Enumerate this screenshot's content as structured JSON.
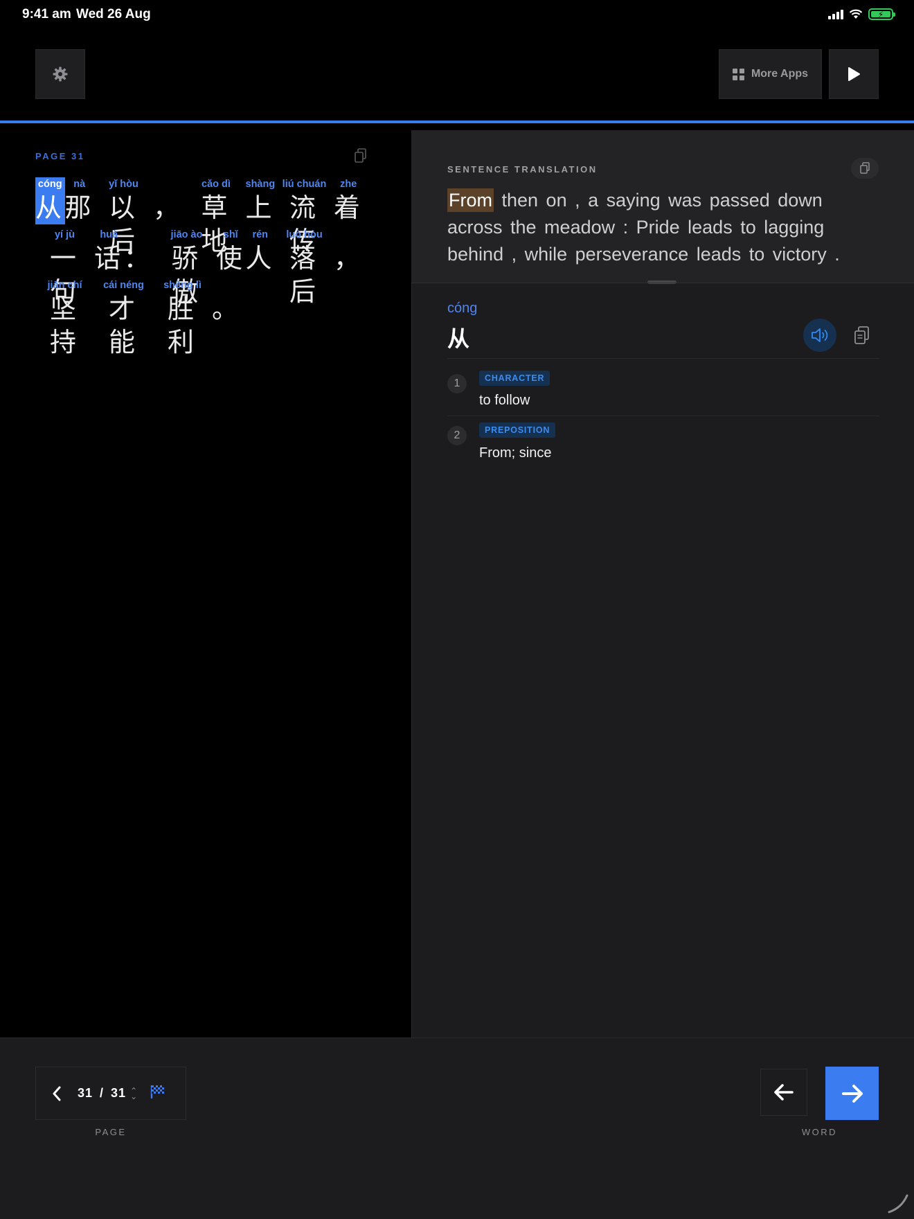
{
  "status_bar": {
    "time": "9:41 am",
    "date": "Wed 26 Aug"
  },
  "toolbar": {
    "settings_icon": "gear-icon",
    "more_apps_label": "More Apps",
    "play_icon": "play-icon",
    "accent_color": "#3b7cf0"
  },
  "reader": {
    "page_label": "PAGE 31",
    "lines": [
      [
        {
          "py": "cóng",
          "hz": "从",
          "selected": true
        },
        {
          "py": "nà",
          "hz": "那"
        },
        {
          "py": "yǐ hòu",
          "hz": "以后"
        },
        {
          "py": "",
          "hz": "，"
        },
        {
          "py": "cǎo dì",
          "hz": "草地"
        },
        {
          "py": "shàng",
          "hz": "上"
        },
        {
          "py": "liú chuán",
          "hz": "流传"
        },
        {
          "py": "zhe",
          "hz": "着"
        }
      ],
      [
        {
          "py": "yí jù",
          "hz": "一句"
        },
        {
          "py": "huà",
          "hz": "话"
        },
        {
          "py": "",
          "hz": "："
        },
        {
          "py": "jiāo ào",
          "hz": "骄傲"
        },
        {
          "py": "shǐ",
          "hz": "使"
        },
        {
          "py": "rén",
          "hz": "人"
        },
        {
          "py": "luò hòu",
          "hz": "落后"
        },
        {
          "py": "",
          "hz": "，"
        }
      ],
      [
        {
          "py": "jiān chí",
          "hz": "坚持"
        },
        {
          "py": "cái néng",
          "hz": "才能"
        },
        {
          "py": "shèng lì",
          "hz": "胜利"
        },
        {
          "py": "",
          "hz": "。"
        }
      ]
    ]
  },
  "translation": {
    "label": "SENTENCE TRANSLATION",
    "highlight": "From",
    "rest": " then on , a saying was passed down across the meadow : Pride leads to lagging behind , while perseverance leads to victory ."
  },
  "word": {
    "pinyin": "cóng",
    "hanzi": "从",
    "definitions": [
      {
        "num": "1",
        "tag": "CHARACTER",
        "text": "to follow"
      },
      {
        "num": "2",
        "tag": "PREPOSITION",
        "text": "From; since"
      }
    ]
  },
  "pager": {
    "current": "31",
    "separator": "/",
    "total": "31",
    "caption": "PAGE"
  },
  "word_nav": {
    "caption": "WORD"
  }
}
